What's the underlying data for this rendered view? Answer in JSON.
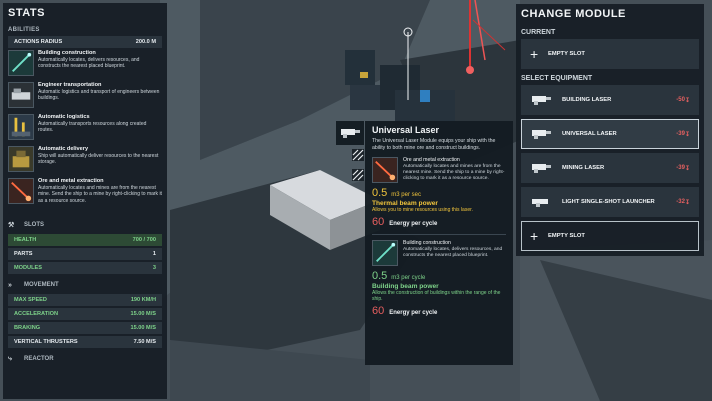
{
  "stats": {
    "title": "STATS",
    "abilities_label": "ABILITIES",
    "actions_radius": {
      "label": "ACTIONS RADIUS",
      "value": "200.0 M"
    },
    "abilities": [
      {
        "name": "Building construction",
        "desc": "Automatically locates, delivers resources, and constructs the nearest placed blueprint."
      },
      {
        "name": "Engineer transportation",
        "desc": "Automatic logistics and transport of engineers between buildings."
      },
      {
        "name": "Automatic logistics",
        "desc": "Automatically transports resources along created routes."
      },
      {
        "name": "Automatic delivery",
        "desc": "Ship will automatically deliver resources to the nearest storage."
      },
      {
        "name": "Ore and metal extraction",
        "desc": "Automatically locates and mines are from the nearest mine. Send the ship to a mine by right-clicking to mark it as a resource source."
      }
    ],
    "slots_label": "SLOTS",
    "slots": [
      {
        "label": "HEALTH",
        "value": "700 / 700"
      },
      {
        "label": "PARTS",
        "value": "1"
      },
      {
        "label": "MODULES",
        "value": "3"
      }
    ],
    "movement_label": "MOVEMENT",
    "movement": [
      {
        "label": "MAX SPEED",
        "value": "190 KM/H"
      },
      {
        "label": "ACCELERATION",
        "value": "15.00 M/S"
      },
      {
        "label": "BRAKING",
        "value": "15.00 M/S"
      },
      {
        "label": "VERTICAL THRUSTERS",
        "value": "7.50 M/S"
      }
    ],
    "reactor_label": "REACTOR"
  },
  "module": {
    "title": "CHANGE MODULE",
    "current_label": "CURRENT",
    "current_slot": "EMPTY SLOT",
    "select_label": "SELECT EQUIPMENT",
    "equipment": [
      {
        "name": "BUILDING LASER",
        "delta": "-50"
      },
      {
        "name": "UNIVERSAL LASER",
        "delta": "-39"
      },
      {
        "name": "MINING LASER",
        "delta": "-39"
      },
      {
        "name": "LIGHT SINGLE-SHOT LAUNCHER",
        "delta": "-32"
      }
    ],
    "empty_slot": "EMPTY SLOT"
  },
  "tooltip": {
    "title": "Universal Laser",
    "desc": "The Universal Laser Module equips your ship with the ability to both mine ore and construct buildings.",
    "sub1": {
      "name": "Ore and metal extraction",
      "desc": "Automatically locates and mines are from the nearest mine. Send the ship to a mine by right-clicking to mark it as a resource source."
    },
    "mine_rate": "0.5",
    "mine_unit": "m3 per sec",
    "thermal_title": "Thermal beam power",
    "thermal_desc": "Allows you to mine resources using this laser.",
    "energy1": "60",
    "energy_label": "Energy per cycle",
    "sub2": {
      "name": "Building construction",
      "desc": "Automatically locates, delivers resources, and constructs the nearest placed blueprint."
    },
    "build_rate": "0.5",
    "build_unit": "m3 per cycle",
    "building_title": "Building beam power",
    "building_desc": "Allows the construction of buildings within the range of the ship.",
    "energy2": "60"
  },
  "colors": {
    "yellow": "#f0c43c",
    "green": "#7ed38a",
    "red": "#e55e5e"
  }
}
